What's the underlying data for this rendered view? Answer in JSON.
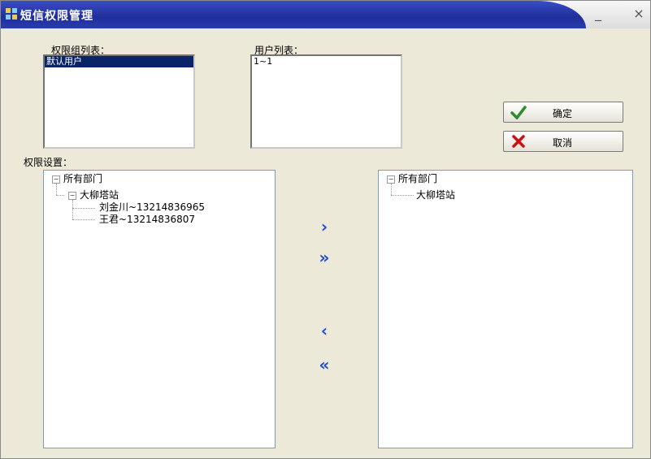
{
  "window": {
    "title": "短信权限管理",
    "minimize_label": "_",
    "close_label": "×"
  },
  "group_list": {
    "label": "权限组列表：",
    "items": [
      "默认用户"
    ]
  },
  "user_list": {
    "label": "用户列表：",
    "items": [
      "1~1"
    ]
  },
  "buttons": {
    "ok_label": "确定",
    "cancel_label": "取消"
  },
  "permission": {
    "label": "权限设置："
  },
  "left_tree": {
    "root": "所有部门",
    "child": "大柳塔站",
    "leaves": [
      "刘金川~13214836965",
      "王君~13214836807"
    ]
  },
  "right_tree": {
    "root": "所有部门",
    "child": "大柳塔站"
  },
  "transfer": {
    "add_one": "›",
    "add_all": "»",
    "remove_one": "‹",
    "remove_all": "«"
  },
  "colors": {
    "title_bar": "#1f2e9a",
    "selection": "#0a246a",
    "arrow": "#1e4bd0",
    "ok_check": "#2e8b2e",
    "cancel_x": "#cc1111"
  }
}
